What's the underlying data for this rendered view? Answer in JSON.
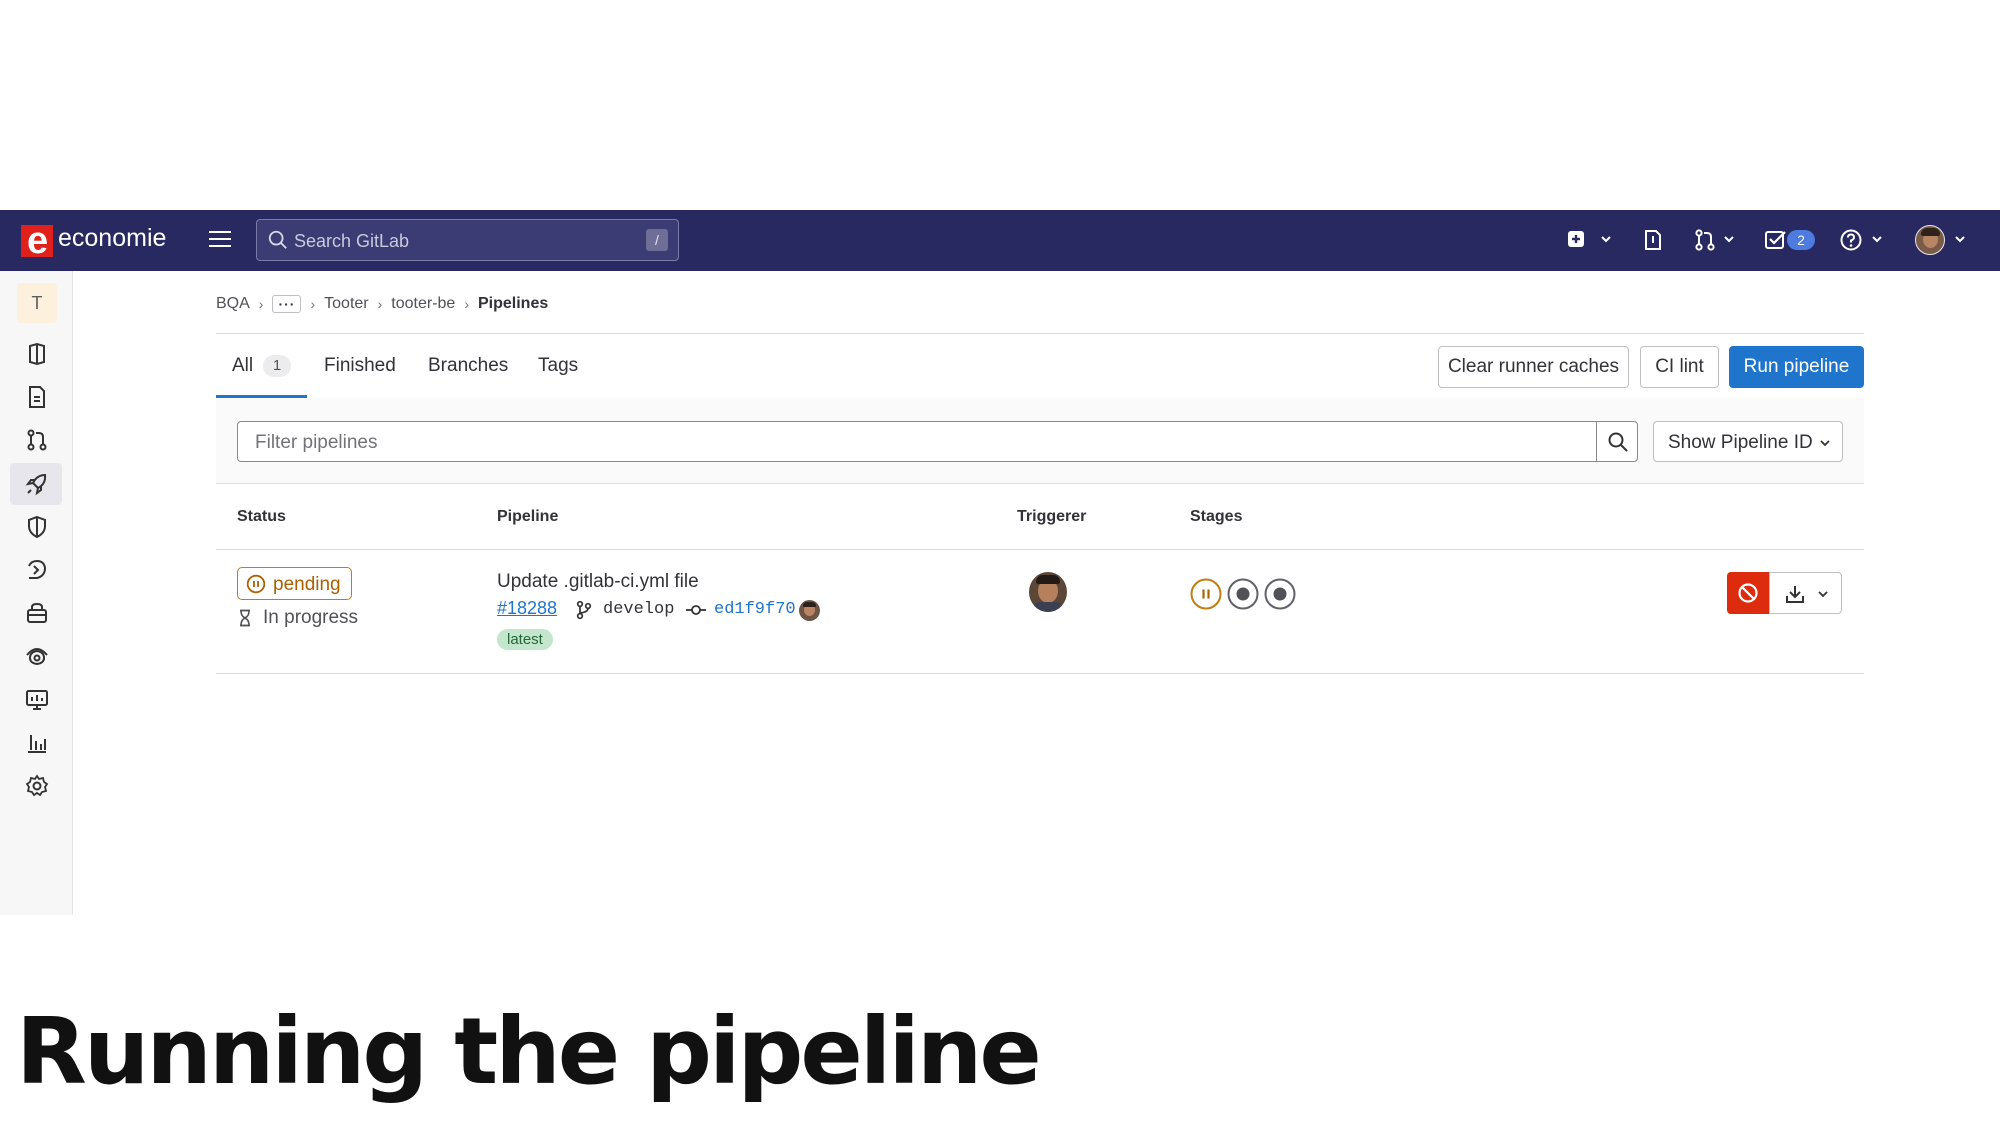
{
  "topbar": {
    "brand": "economie",
    "brand_logo_letter": "e",
    "search_placeholder": "Search GitLab",
    "search_shortcut": "/",
    "todo_count": "2",
    "background_color": "#292961"
  },
  "sidebar": {
    "project_initial": "T",
    "items": [
      {
        "icon": "project-overview-icon"
      },
      {
        "icon": "issues-icon"
      },
      {
        "icon": "merge-requests-icon"
      },
      {
        "icon": "ci-cd-rocket-icon",
        "active": true
      },
      {
        "icon": "security-shield-icon"
      },
      {
        "icon": "deployments-icon"
      },
      {
        "icon": "packages-icon"
      },
      {
        "icon": "infrastructure-icon"
      },
      {
        "icon": "monitor-icon"
      },
      {
        "icon": "analytics-icon"
      },
      {
        "icon": "settings-gear-icon"
      }
    ]
  },
  "breadcrumb": [
    "BQA",
    "Tooter",
    "tooter-be",
    "Pipelines"
  ],
  "tabs": {
    "all": "All",
    "all_count": "1",
    "finished": "Finished",
    "branches": "Branches",
    "tags": "Tags"
  },
  "actions": {
    "clear_caches": "Clear runner caches",
    "ci_lint": "CI lint",
    "run_pipeline": "Run pipeline"
  },
  "filter": {
    "placeholder": "Filter pipelines",
    "show_id": "Show Pipeline ID"
  },
  "table": {
    "headers": {
      "status": "Status",
      "pipeline": "Pipeline",
      "triggerer": "Triggerer",
      "stages": "Stages"
    },
    "rows": [
      {
        "status": "pending",
        "status_detail": "In progress",
        "commit_title": "Update .gitlab-ci.yml file",
        "pipeline_id": "#18288",
        "branch": "develop",
        "commit_sha": "ed1f9f70",
        "tag": "latest",
        "stages": [
          "pending",
          "created",
          "created"
        ]
      }
    ]
  },
  "slide_title": "Running the pipeline",
  "colors": {
    "primary": "#1f75cb",
    "pending": "#ab6100",
    "danger": "#dd2b0e",
    "latest_badge": "#c3e6cd"
  }
}
